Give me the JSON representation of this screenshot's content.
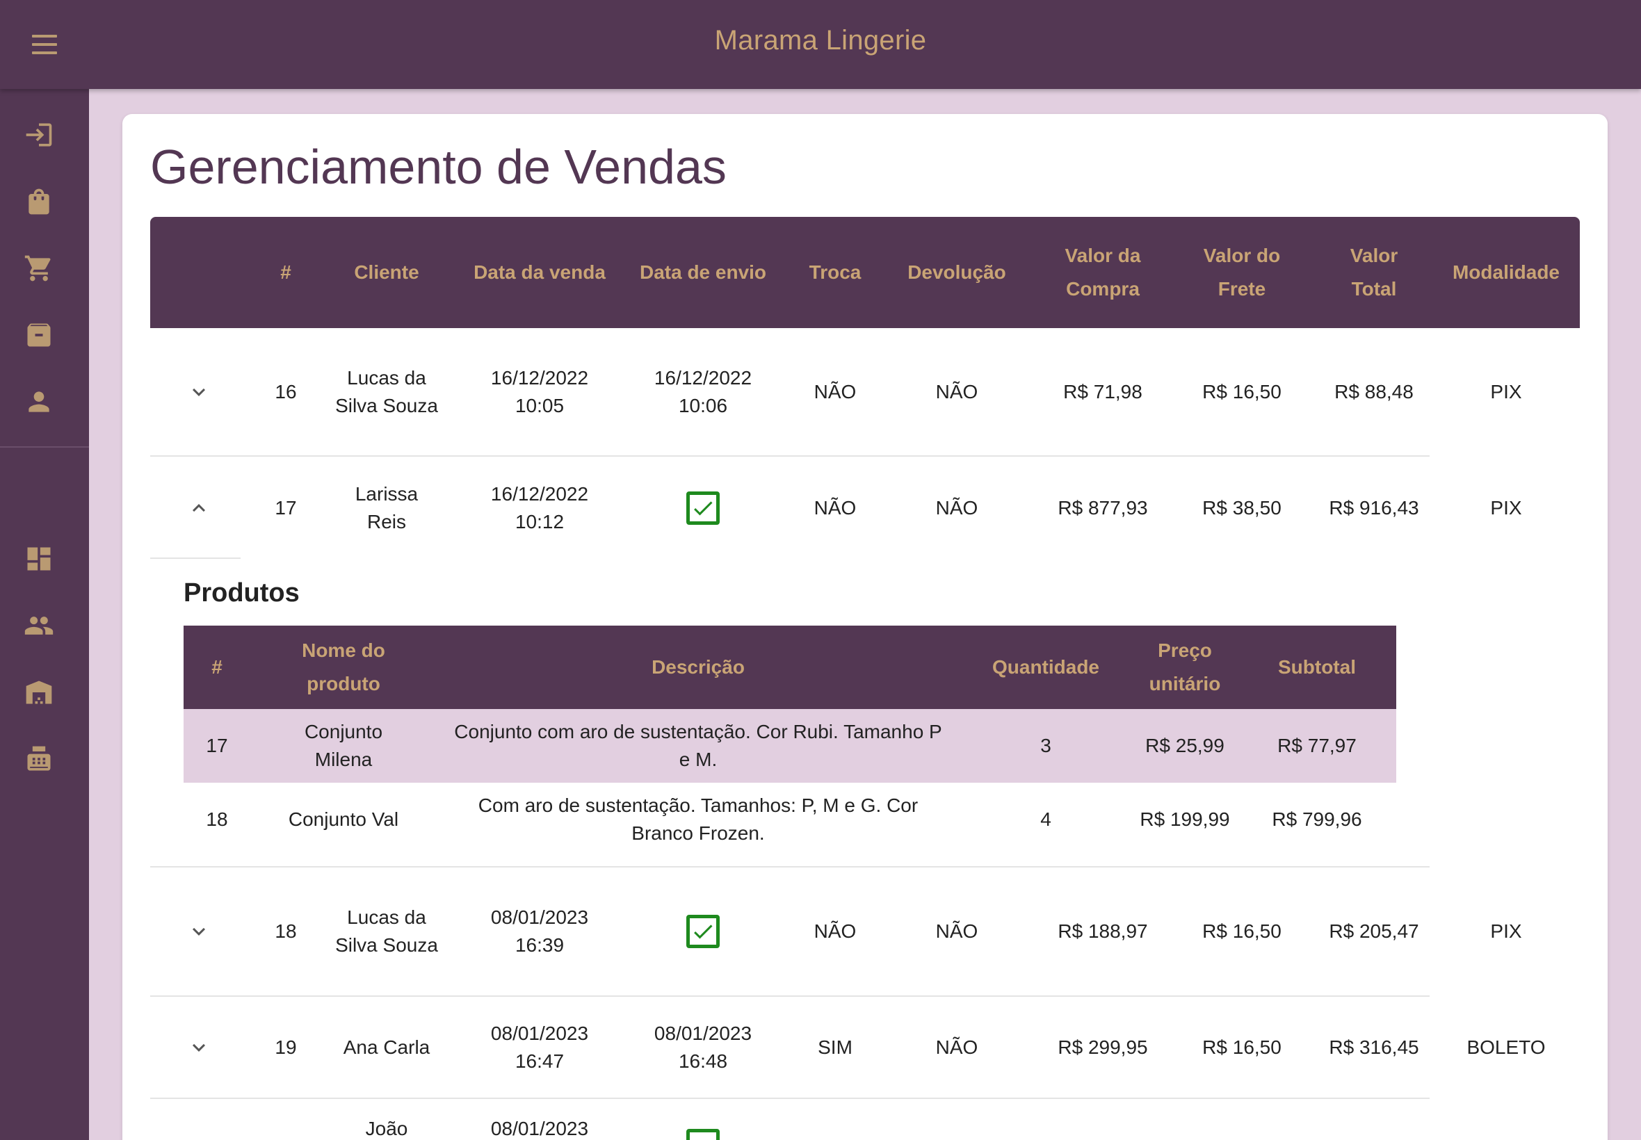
{
  "app": {
    "title": "Marama Lingerie"
  },
  "sidebar": {
    "items": [
      {
        "name": "login-icon"
      },
      {
        "name": "shopping-bag-icon"
      },
      {
        "name": "cart-icon"
      },
      {
        "name": "archive-icon"
      },
      {
        "name": "person-icon"
      },
      {
        "name": "dashboard-icon"
      },
      {
        "name": "people-icon"
      },
      {
        "name": "warehouse-icon"
      },
      {
        "name": "cash-register-icon"
      }
    ]
  },
  "page": {
    "title": "Gerenciamento de Vendas"
  },
  "sales_table": {
    "headers": {
      "num": "#",
      "client": "Cliente",
      "sale_date": "Data da venda",
      "ship_date": "Data de envio",
      "exchange": "Troca",
      "return": "Devolução",
      "purchase_value": "Valor da Compra",
      "freight_value": "Valor do Frete",
      "total_value": "Valor Total",
      "modality": "Modalidade"
    },
    "rows": [
      {
        "num": "16",
        "client": "Lucas da Silva Souza",
        "sale_date": "16/12/2022 10:05",
        "ship_date": "16/12/2022 10:06",
        "exchange": "NÃO",
        "return": "NÃO",
        "purchase": "R$ 71,98",
        "freight": "R$ 16,50",
        "total": "R$ 88,48",
        "modality": "PIX"
      },
      {
        "num": "17",
        "client": "Larissa Reis",
        "sale_date": "16/12/2022 10:12",
        "ship_date": "",
        "exchange": "NÃO",
        "return": "NÃO",
        "purchase": "R$ 877,93",
        "freight": "R$ 38,50",
        "total": "R$ 916,43",
        "modality": "PIX"
      },
      {
        "num": "18",
        "client": "Lucas da Silva Souza",
        "sale_date": "08/01/2023 16:39",
        "ship_date": "",
        "exchange": "NÃO",
        "return": "NÃO",
        "purchase": "R$ 188,97",
        "freight": "R$ 16,50",
        "total": "R$ 205,47",
        "modality": "PIX"
      },
      {
        "num": "19",
        "client": "Ana Carla",
        "sale_date": "08/01/2023 16:47",
        "ship_date": "08/01/2023 16:48",
        "exchange": "SIM",
        "return": "NÃO",
        "purchase": "R$ 299,95",
        "freight": "R$ 16,50",
        "total": "R$ 316,45",
        "modality": "BOLETO"
      },
      {
        "num": "",
        "client": "João",
        "sale_date": "08/01/2023",
        "ship_date": "",
        "exchange": "",
        "return": "",
        "purchase": "",
        "freight": "",
        "total": "",
        "modality": ""
      }
    ]
  },
  "products": {
    "title": "Produtos",
    "headers": {
      "num": "#",
      "name": "Nome do produto",
      "description": "Descrição",
      "quantity": "Quantidade",
      "unit_price": "Preço unitário",
      "subtotal": "Subtotal"
    },
    "rows": [
      {
        "num": "17",
        "name": "Conjunto Milena",
        "description": "Conjunto com aro de sustentação. Cor Rubi. Tamanho P e M.",
        "quantity": "3",
        "unit_price": "R$ 25,99",
        "subtotal": "R$ 77,97"
      },
      {
        "num": "18",
        "name": "Conjunto Val",
        "description": "Com aro de sustentação. Tamanhos: P, M e G. Cor Branco Frozen.",
        "quantity": "4",
        "unit_price": "R$ 199,99",
        "subtotal": "R$ 799,96"
      }
    ]
  },
  "colors": {
    "primary": "#533753",
    "accent": "#c9a475",
    "background": "#e2cfe0",
    "check": "#1e8a1e",
    "highlight_row": "#e2cfe0"
  }
}
